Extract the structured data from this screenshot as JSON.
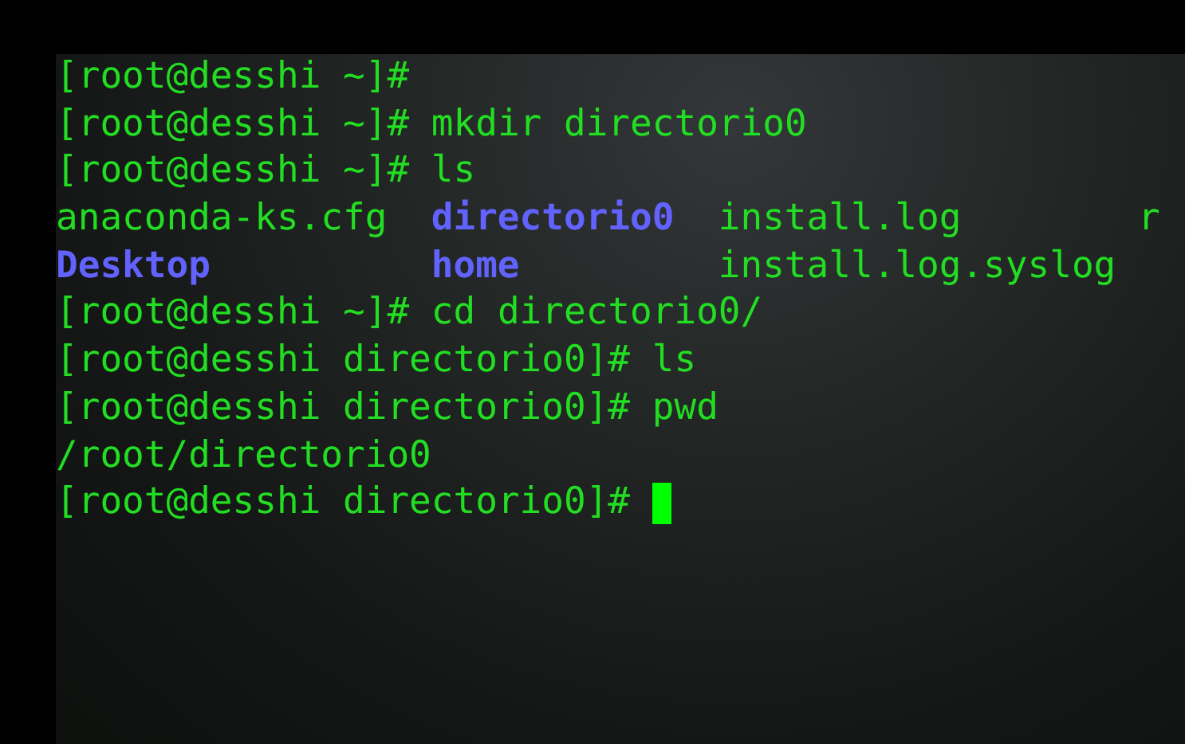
{
  "terminal": {
    "lines": [
      {
        "kind": "prompt",
        "prompt": "[root@desshi ~]#",
        "cursor": false
      },
      {
        "kind": "prompt",
        "prompt": "[root@desshi ~]#",
        "command": "mkdir directorio0",
        "cursor": false
      },
      {
        "kind": "prompt",
        "prompt": "[root@desshi ~]#",
        "command": "ls",
        "cursor": false
      },
      {
        "kind": "listing",
        "entries": [
          {
            "name": "anaconda-ks.cfg",
            "kind": "file"
          },
          {
            "name": "directorio0",
            "kind": "dir"
          },
          {
            "name": "install.log",
            "kind": "file"
          },
          {
            "name": "r",
            "kind": "file"
          }
        ]
      },
      {
        "kind": "listing",
        "entries": [
          {
            "name": "Desktop",
            "kind": "dir"
          },
          {
            "name": "home",
            "kind": "dir"
          },
          {
            "name": "install.log.syslog",
            "kind": "file"
          }
        ]
      },
      {
        "kind": "prompt",
        "prompt": "[root@desshi ~]#",
        "command": "cd directorio0/",
        "cursor": false
      },
      {
        "kind": "prompt",
        "prompt": "[root@desshi directorio0]#",
        "command": "ls",
        "cursor": false
      },
      {
        "kind": "prompt",
        "prompt": "[root@desshi directorio0]#",
        "command": "pwd",
        "cursor": false
      },
      {
        "kind": "output",
        "text": "/root/directorio0"
      },
      {
        "kind": "prompt",
        "prompt": "[root@desshi directorio0]#",
        "cursor": true
      }
    ]
  }
}
